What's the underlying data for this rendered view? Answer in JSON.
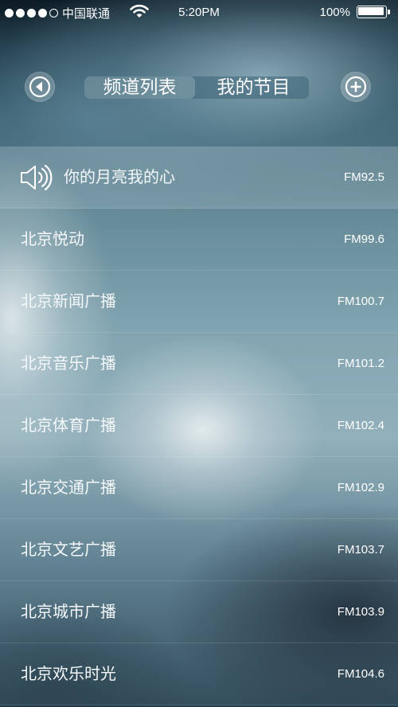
{
  "status_bar": {
    "carrier": "中国联通",
    "time": "5:20PM",
    "battery": "100%",
    "signal_bars": 4
  },
  "nav": {
    "back_icon": "back-arrow-icon",
    "add_icon": "plus-icon",
    "tabs": [
      {
        "label": "频道列表",
        "active": true
      },
      {
        "label": "我的节目",
        "active": false
      }
    ]
  },
  "channels": [
    {
      "name": "你的月亮我的心",
      "freq": "FM92.5",
      "playing": true
    },
    {
      "name": "北京悦动",
      "freq": "FM99.6"
    },
    {
      "name": "北京新闻广播",
      "freq": "FM100.7"
    },
    {
      "name": "北京音乐广播",
      "freq": "FM101.2"
    },
    {
      "name": "北京体育广播",
      "freq": "FM102.4"
    },
    {
      "name": "北京交通广播",
      "freq": "FM102.9"
    },
    {
      "name": "北京文艺广播",
      "freq": "FM103.7"
    },
    {
      "name": "北京城市广播",
      "freq": "FM103.9"
    },
    {
      "name": "北京欢乐时光",
      "freq": "FM104.6"
    }
  ]
}
